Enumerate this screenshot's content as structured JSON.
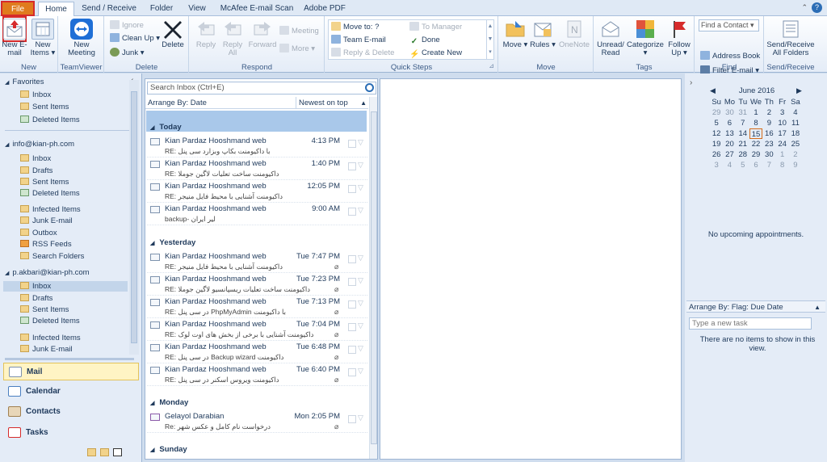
{
  "tabs": [
    "File",
    "Home",
    "Send / Receive",
    "Folder",
    "View",
    "McAfee E-mail Scan",
    "Adobe PDF"
  ],
  "help_icon": "?",
  "ribbon": {
    "new": {
      "new_email": "New E-mail",
      "new_items": "New Items ▾",
      "label": "New"
    },
    "teamviewer": {
      "new_meeting": "New Meeting",
      "label": "TeamViewer"
    },
    "delete": {
      "ignore": "Ignore",
      "clean_up": "Clean Up ▾",
      "junk": "Junk ▾",
      "delete": "Delete",
      "label": "Delete"
    },
    "respond": {
      "reply": "Reply",
      "reply_all": "Reply All",
      "forward": "Forward",
      "meeting": "Meeting",
      "more": "More ▾",
      "label": "Respond"
    },
    "quick_steps": {
      "move_to": "Move to: ?",
      "team_email": "Team E-mail",
      "reply_delete": "Reply & Delete",
      "to_manager": "To Manager",
      "done": "Done",
      "create_new": "Create New",
      "label": "Quick Steps"
    },
    "move": {
      "move": "Move ▾",
      "rules": "Rules ▾",
      "onenote": "OneNote",
      "label": "Move"
    },
    "tags": {
      "unread_read": "Unread/ Read",
      "categorize": "Categorize ▾",
      "follow_up": "Follow Up ▾",
      "label": "Tags"
    },
    "find": {
      "find_contact": "Find a Contact ▾",
      "address_book": "Address Book",
      "filter_email": "Filter E-mail ▾",
      "label": "Find"
    },
    "send_receive": {
      "button": "Send/Receive All Folders",
      "label": "Send/Receive"
    }
  },
  "nav": {
    "favorites": "Favorites",
    "fav_items": [
      "Inbox",
      "Sent Items",
      "Deleted Items"
    ],
    "account1": "info@kian-ph.com",
    "account1_items": [
      "Inbox",
      "Drafts",
      "Sent Items",
      "Deleted Items",
      "Infected Items",
      "Junk E-mail",
      "Outbox",
      "RSS Feeds",
      "Search Folders"
    ],
    "account2": "p.akbari@kian-ph.com",
    "account2_items": [
      "Inbox",
      "Drafts",
      "Sent Items",
      "Deleted Items",
      "Infected Items",
      "Junk E-mail"
    ],
    "buttons": [
      "Mail",
      "Calendar",
      "Contacts",
      "Tasks"
    ]
  },
  "list": {
    "search_placeholder": "Search Inbox (Ctrl+E)",
    "arrange_by": "Arrange By: Date",
    "sort_order": "Newest on top",
    "groups": [
      "Today",
      "Yesterday",
      "Monday",
      "Sunday"
    ],
    "items": [
      {
        "from": "Kian Pardaz Hooshmand web",
        "time": "4:13 PM",
        "subject": "RE: با داکیومنت بکاپ وبزارد سی پنل"
      },
      {
        "from": "Kian Pardaz Hooshmand web",
        "time": "1:40 PM",
        "subject": "RE: داکیومنت ساخت تعلیات لاگین جوملا"
      },
      {
        "from": "Kian Pardaz Hooshmand web",
        "time": "12:05 PM",
        "subject": "RE: داکیومنت آشنایی با محیط فایل منیجر"
      },
      {
        "from": "Kian Pardaz Hooshmand web",
        "time": "9:00 AM",
        "subject": "backup- لیر ایران"
      },
      {
        "from": "Kian Pardaz Hooshmand web",
        "time": "Tue 7:47 PM",
        "subject": "RE: داکیومنت آشنایی با محیط فایل منیجر"
      },
      {
        "from": "Kian Pardaz Hooshmand web",
        "time": "Tue 7:23 PM",
        "subject": "RE: داکیومنت ساخت تعلیات ریسپانسیو لاگین جوملا"
      },
      {
        "from": "Kian Pardaz Hooshmand web",
        "time": "Tue 7:13 PM",
        "subject": "RE: در سی پنل PhpMyAdmin با داکیومنت"
      },
      {
        "from": "Kian Pardaz Hooshmand web",
        "time": "Tue 7:04 PM",
        "subject": "RE: داکیومنت آشنایی با برخی از بخش های اوت لوک"
      },
      {
        "from": "Kian Pardaz Hooshmand web",
        "time": "Tue 6:48 PM",
        "subject": "RE: در سی پنل Backup wizard داکیومنت"
      },
      {
        "from": "Kian Pardaz Hooshmand web",
        "time": "Tue 6:40 PM",
        "subject": "RE: داکیومنت ویروس اسکنر در سی پنل"
      },
      {
        "from": "Gelayol Darabian",
        "time": "Mon 2:05 PM",
        "subject": "Re: درخواست نام کامل و عکس شهر"
      }
    ]
  },
  "calendar": {
    "title": "June 2016",
    "weekdays": [
      "Su",
      "Mo",
      "Tu",
      "We",
      "Th",
      "Fr",
      "Sa"
    ],
    "days": [
      "29",
      "30",
      "31",
      "1",
      "2",
      "3",
      "4",
      "5",
      "6",
      "7",
      "8",
      "9",
      "10",
      "11",
      "12",
      "13",
      "14",
      "15",
      "16",
      "17",
      "18",
      "19",
      "20",
      "21",
      "22",
      "23",
      "24",
      "25",
      "26",
      "27",
      "28",
      "29",
      "30",
      "1",
      "2",
      "3",
      "4",
      "5",
      "6",
      "7",
      "8",
      "9"
    ],
    "today": "15"
  },
  "todo": {
    "no_appointments": "No upcoming appointments.",
    "arrange": "Arrange By: Flag: Due Date",
    "new_task_placeholder": "Type a new task",
    "no_items": "There are no items to show in this view."
  },
  "colors": {
    "file_tab": "#e07b1d",
    "highlight": "#d62b2b",
    "selected_group": "#a9c8ea",
    "accent": "#2b6db5"
  }
}
